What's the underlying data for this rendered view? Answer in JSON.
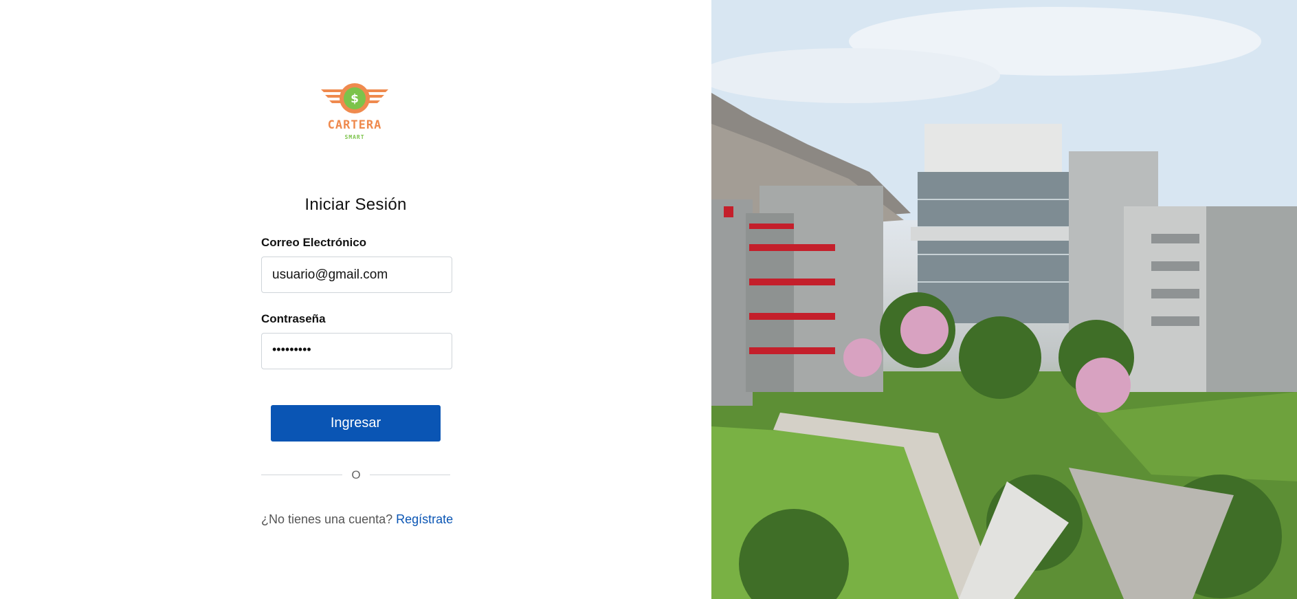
{
  "brand": {
    "name": "CARTERA",
    "tagline": "SMART",
    "symbol": "$",
    "colors": {
      "orange": "#ef8a4e",
      "green": "#7cc34b"
    }
  },
  "login": {
    "title": "Iniciar Sesión",
    "email_label": "Correo Electrónico",
    "email_value": "usuario@gmail.com",
    "password_label": "Contraseña",
    "password_value": "•••••••••",
    "submit_label": "Ingresar",
    "divider_text": "O",
    "signup_prompt": "¿No tienes una cuenta?",
    "signup_link": "Regístrate"
  },
  "colors": {
    "primary": "#0a55b4",
    "border": "#cfd4d9"
  },
  "hero": {
    "description": "campus-photo"
  }
}
